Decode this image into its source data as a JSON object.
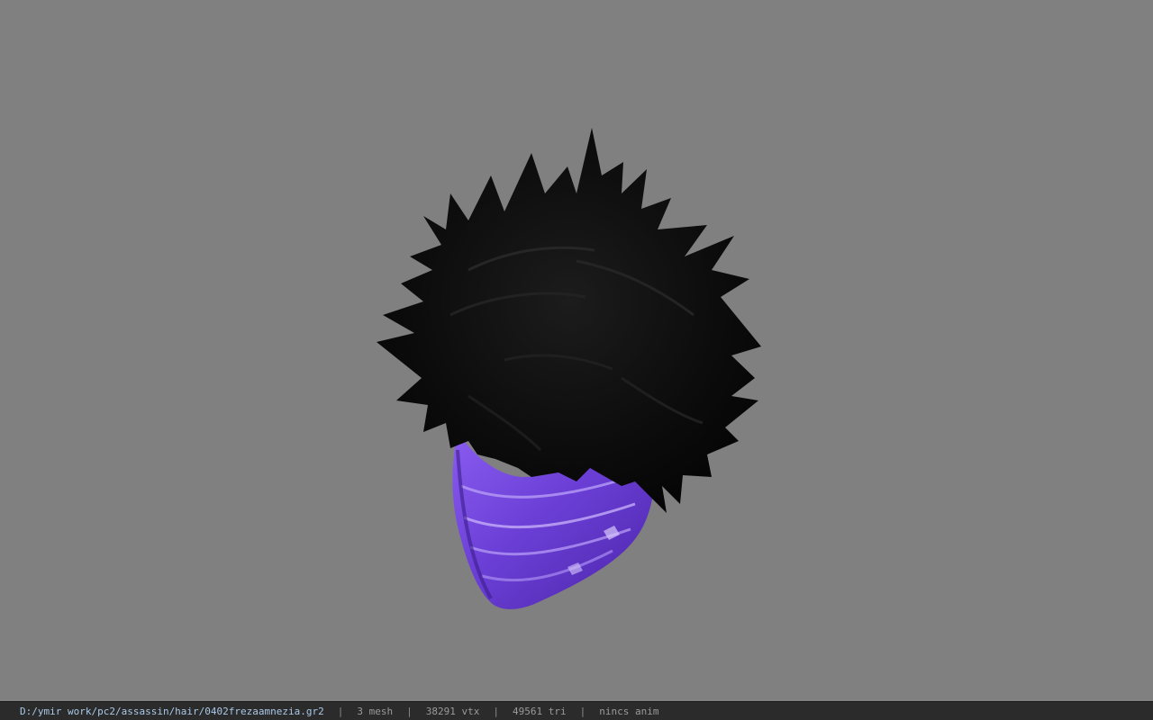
{
  "viewer": {
    "background_color": "#808080",
    "model_icon": "hair-model-icon",
    "hair_color": "#0a0a0a",
    "mask_color": "#6b3fd6"
  },
  "statusbar": {
    "path": "D:/ymir work/pc2/assassin/hair/0402frezaamnezia.gr2",
    "separator": "|",
    "mesh": "3 mesh",
    "vtx": "38291 vtx",
    "tri": "49561 tri",
    "anim": "nincs anim"
  }
}
